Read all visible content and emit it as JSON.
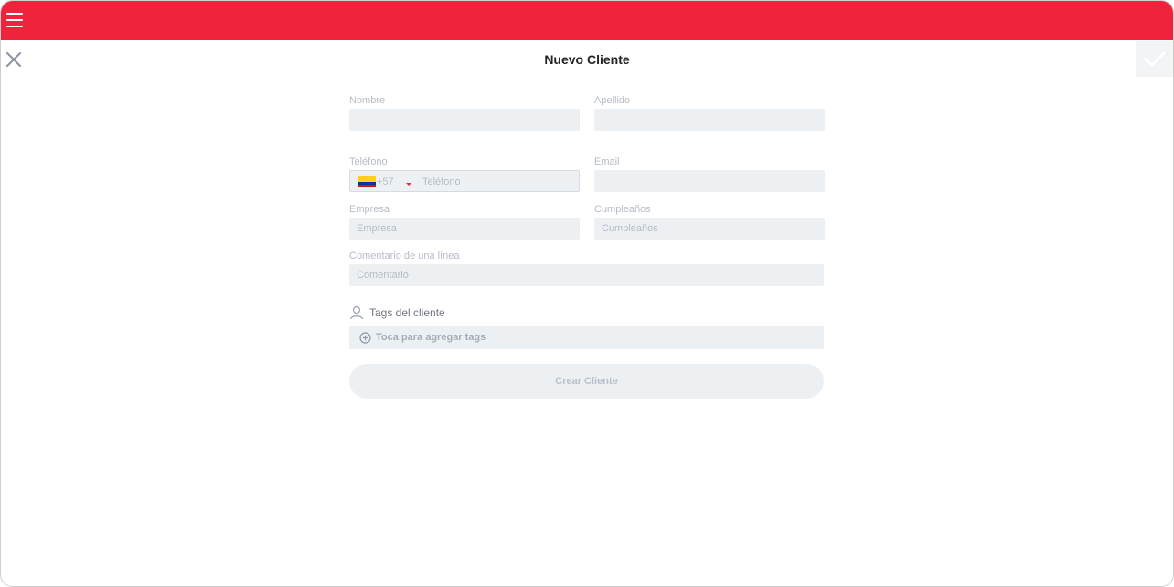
{
  "header": {
    "title": "Nuevo Cliente",
    "accent_color": "#ef233c"
  },
  "icons": {
    "menu": "hamburger-icon",
    "close": "close-icon",
    "confirm": "check-icon",
    "user": "user-icon",
    "add": "plus-circle-icon"
  },
  "form": {
    "nombre": {
      "label": "Nombre",
      "value": "",
      "placeholder": ""
    },
    "apellido": {
      "label": "Apellido",
      "value": "",
      "placeholder": ""
    },
    "telefono": {
      "label": "Teléfono",
      "country_code": "+57",
      "placeholder": "Teléfono"
    },
    "email": {
      "label": "Email",
      "value": "",
      "placeholder": ""
    },
    "empresa": {
      "label": "Empresa",
      "placeholder": "Empresa"
    },
    "cumpleanos": {
      "label": "Cumpleaños",
      "placeholder": "Cumpleaños"
    },
    "comentario": {
      "label": "Comentario de una línea",
      "placeholder": "Comentario"
    }
  },
  "tags": {
    "heading": "Tags del cliente",
    "add_label": "Toca para agregar tags"
  },
  "actions": {
    "create_label": "Crear Cliente"
  }
}
